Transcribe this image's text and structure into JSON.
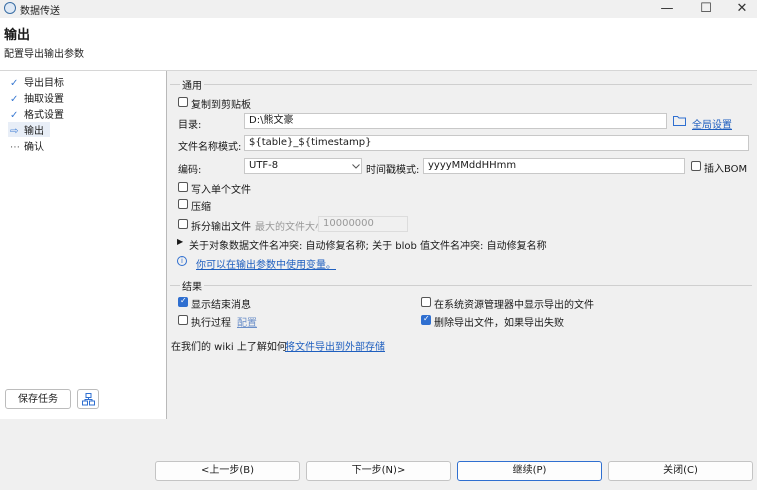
{
  "window": {
    "title": "数据传送",
    "minimize": "—",
    "maximize": "☐",
    "close": "✕"
  },
  "header": {
    "title": "输出",
    "subtitle": "配置导出输出参数"
  },
  "steps": [
    {
      "label": "导出目标",
      "mark": "✓"
    },
    {
      "label": "抽取设置",
      "mark": "✓"
    },
    {
      "label": "格式设置",
      "mark": "✓"
    },
    {
      "label": "输出",
      "mark": "⇨"
    },
    {
      "label": "确认",
      "mark": "⋯"
    }
  ],
  "left_buttons": {
    "save_task": "保存任务"
  },
  "general": {
    "legend": "通用",
    "copy_clipboard": "复制到剪贴板",
    "dir_label": "目录:",
    "dir_value": "D:\\熊文豪",
    "global_settings": "全局设置",
    "filename_label": "文件名称模式:",
    "filename_value": "${table}_${timestamp}",
    "encoding_label": "编码:",
    "encoding_value": "UTF-8",
    "timestamp_label": "时间戳模式:",
    "timestamp_value": "yyyyMMddHHmm",
    "insert_bom": "插入BOM",
    "single_file": "写入单个文件",
    "compress": "压缩",
    "split_output": "拆分输出文件",
    "max_size_label": "最大的文件大小:",
    "max_size_value": "10000000",
    "conflict_text": "关于对象数据文件名冲突: 自动修复名称; 关于 blob 值文件名冲突: 自动修复名称",
    "variables_link": "你可以在输出参数中使用变量。"
  },
  "result": {
    "legend": "结果",
    "show_finish": "显示结束消息",
    "show_finish_checked": true,
    "show_in_explorer": "在系统资源管理器中显示导出的文件",
    "show_in_explorer_checked": false,
    "exec_process": "执行过程",
    "exec_process_checked": false,
    "configure": "配置",
    "delete_on_fail": "删除导出文件，如果导出失败",
    "delete_on_fail_checked": true
  },
  "wiki": {
    "prefix": "在我们的 wiki 上了解如何 ",
    "link": "将文件导出到外部存储"
  },
  "footer": {
    "back": "<上一步(B)",
    "next": "下一步(N)>",
    "proceed": "继续(P)",
    "close": "关闭(C)"
  },
  "colors": {
    "accent": "#2f6fd0",
    "link": "#1f5fbf"
  }
}
